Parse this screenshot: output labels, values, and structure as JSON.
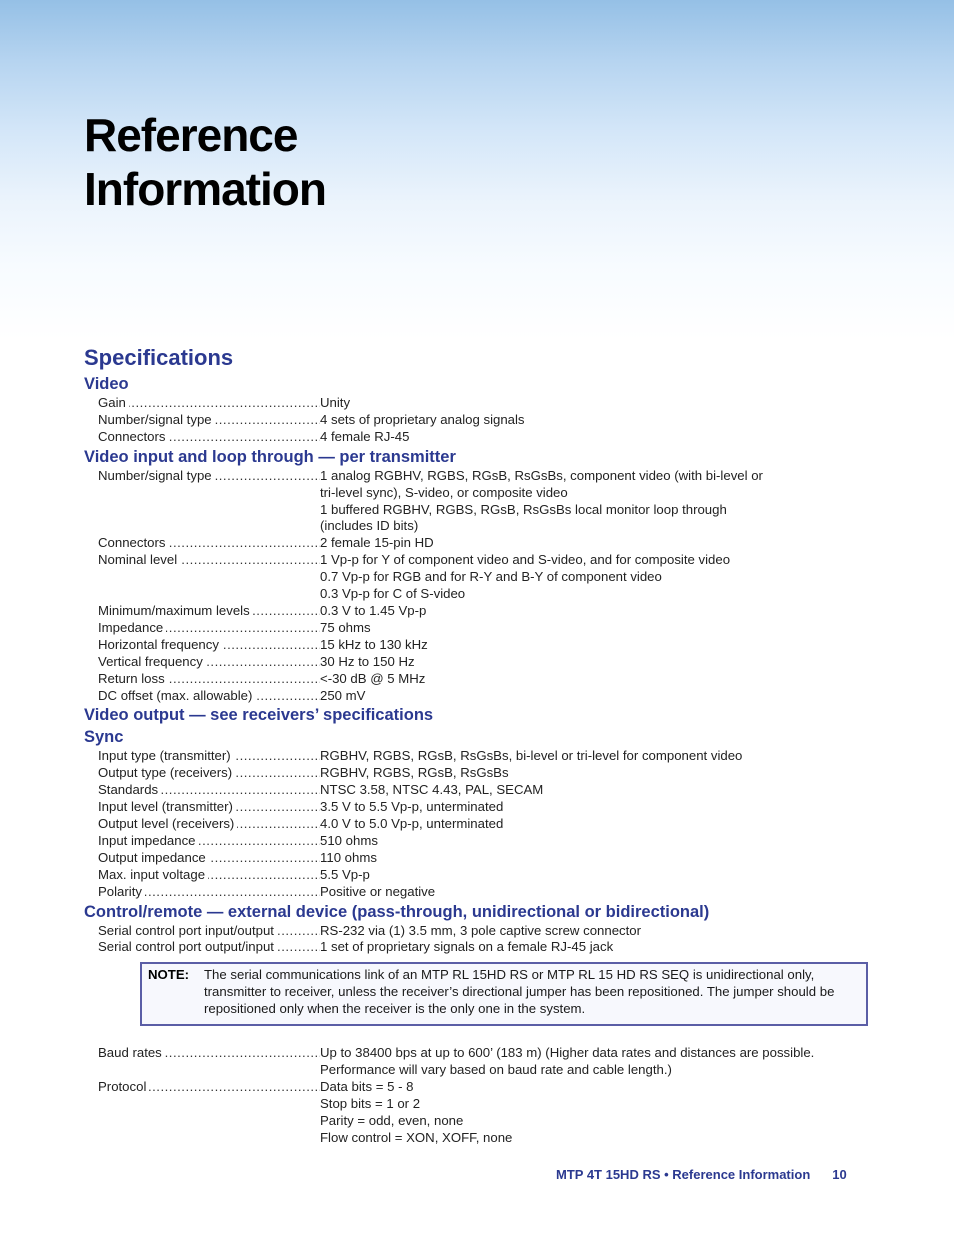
{
  "header": {
    "title_line1": "Reference",
    "title_line2": "Information"
  },
  "specifications": {
    "title": "Specifications",
    "sections": [
      {
        "heading": "Video",
        "rows": [
          {
            "label": "Gain",
            "value": [
              "Unity"
            ]
          },
          {
            "label": "Number/signal type",
            "value": [
              "4 sets of proprietary analog signals"
            ]
          },
          {
            "label": "Connectors",
            "value": [
              "4 female RJ-45"
            ]
          }
        ]
      },
      {
        "heading": "Video input and loop through — per transmitter",
        "rows": [
          {
            "label": "Number/signal type",
            "value": [
              "1 analog RGBHV, RGBS, RGsB, RsGsBs, component video (with bi-level or",
              "tri-level sync), S-video, or composite video",
              "1 buffered RGBHV, RGBS, RGsB, RsGsBs local monitor loop through",
              "(includes ID bits)"
            ]
          },
          {
            "label": "Connectors",
            "value": [
              "2 female 15-pin HD"
            ]
          },
          {
            "label": "Nominal level",
            "value": [
              "1 Vp-p for Y of component video and S-video, and for composite video",
              "0.7 Vp-p for RGB and for R-Y and B-Y of component video",
              "0.3 Vp-p for C of S-video"
            ]
          },
          {
            "label": "Minimum/maximum levels",
            "value": [
              "0.3 V to 1.45 Vp-p"
            ]
          },
          {
            "label": "Impedance",
            "value": [
              "75 ohms"
            ]
          },
          {
            "label": "Horizontal frequency",
            "value": [
              "15 kHz to 130 kHz"
            ]
          },
          {
            "label": "Vertical frequency",
            "value": [
              "30 Hz to 150 Hz"
            ]
          },
          {
            "label": "Return loss",
            "value": [
              "<-30 dB @ 5 MHz"
            ]
          },
          {
            "label": "DC offset (max. allowable)",
            "value": [
              "250 mV"
            ]
          }
        ]
      },
      {
        "heading": "Video output — see receivers’ specifications",
        "rows": []
      },
      {
        "heading": "Sync",
        "rows": [
          {
            "label": "Input type (transmitter)",
            "value": [
              "RGBHV, RGBS, RGsB, RsGsBs, bi-level or tri-level for component video"
            ]
          },
          {
            "label": "Output type (receivers)",
            "value": [
              "RGBHV, RGBS, RGsB, RsGsBs"
            ]
          },
          {
            "label": "Standards",
            "value": [
              "NTSC 3.58, NTSC 4.43,  PAL, SECAM"
            ]
          },
          {
            "label": "Input level (transmitter)",
            "value": [
              "3.5 V to 5.5 Vp-p, unterminated"
            ]
          },
          {
            "label": "Output level (receivers)",
            "value": [
              "4.0 V to 5.0 Vp-p, unterminated"
            ]
          },
          {
            "label": "Input impedance",
            "value": [
              "510 ohms"
            ]
          },
          {
            "label": "Output impedance",
            "value": [
              "110 ohms"
            ]
          },
          {
            "label": "Max. input voltage",
            "value": [
              "5.5 Vp-p"
            ]
          },
          {
            "label": "Polarity",
            "value": [
              "Positive or negative"
            ]
          }
        ]
      },
      {
        "heading": "Control/remote — external device (pass-through, unidirectional or bidirectional)",
        "rows": [
          {
            "label": "Serial control port input/output",
            "value": [
              "RS-232 via (1) 3.5 mm, 3 pole captive screw connector"
            ]
          },
          {
            "label": "Serial control port output/input",
            "value": [
              "1 set of proprietary signals on a female RJ-45 jack"
            ]
          }
        ],
        "note": {
          "label": "NOTE:",
          "text": "The serial communications link of an MTP RL 15HD RS or MTP RL 15 HD RS SEQ is unidirectional only, transmitter to receiver, unless the receiver’s directional jumper has been repositioned.  The jumper should be repositioned only when the receiver is the only one in the system."
        },
        "rows_after_note": [
          {
            "label": "Baud rates",
            "value": [
              "Up to 38400 bps at up to 600’ (183 m) (Higher data rates and distances are possible.",
              "Performance will vary based on baud rate and cable length.)"
            ]
          },
          {
            "label": "Protocol",
            "value": [
              "Data bits = 5 - 8",
              "Stop bits = 1 or 2",
              "Parity = odd, even, none",
              "Flow control = XON, XOFF, none"
            ]
          }
        ]
      }
    ]
  },
  "footer": {
    "text": "MTP 4T 15HD RS • Reference Information",
    "page_number": "10"
  },
  "colors": {
    "heading_blue": "#2b3990",
    "note_border": "#5b5ea6",
    "banner_top": "#95c0e6"
  }
}
